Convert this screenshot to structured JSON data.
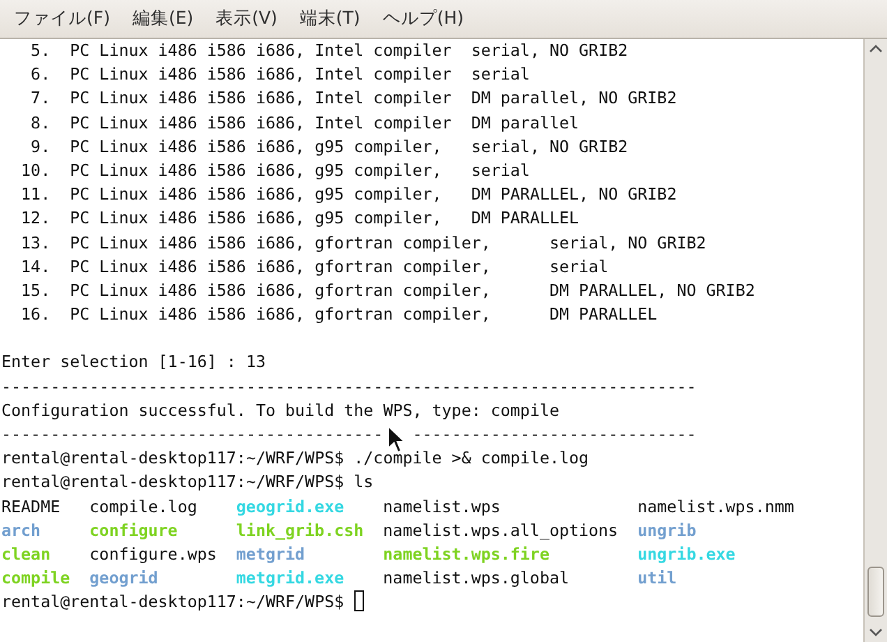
{
  "menu": [
    {
      "label": "ファイル(F)"
    },
    {
      "label": "編集(E)"
    },
    {
      "label": "表示(V)"
    },
    {
      "label": "端末(T)"
    },
    {
      "label": "ヘルプ(H)"
    }
  ],
  "terminal": {
    "lines": [
      {
        "kind": "text",
        "text": "   5.  PC Linux i486 i586 i686, Intel compiler  serial, NO GRIB2"
      },
      {
        "kind": "text",
        "text": "   6.  PC Linux i486 i586 i686, Intel compiler  serial"
      },
      {
        "kind": "text",
        "text": "   7.  PC Linux i486 i586 i686, Intel compiler  DM parallel, NO GRIB2"
      },
      {
        "kind": "text",
        "text": "   8.  PC Linux i486 i586 i686, Intel compiler  DM parallel"
      },
      {
        "kind": "text",
        "text": "   9.  PC Linux i486 i586 i686, g95 compiler,   serial, NO GRIB2"
      },
      {
        "kind": "text",
        "text": "  10.  PC Linux i486 i586 i686, g95 compiler,   serial"
      },
      {
        "kind": "text",
        "text": "  11.  PC Linux i486 i586 i686, g95 compiler,   DM PARALLEL, NO GRIB2"
      },
      {
        "kind": "text",
        "text": "  12.  PC Linux i486 i586 i686, g95 compiler,   DM PARALLEL"
      },
      {
        "kind": "text",
        "text": "  13.  PC Linux i486 i586 i686, gfortran compiler,      serial, NO GRIB2"
      },
      {
        "kind": "text",
        "text": "  14.  PC Linux i486 i586 i686, gfortran compiler,      serial"
      },
      {
        "kind": "text",
        "text": "  15.  PC Linux i486 i586 i686, gfortran compiler,      DM PARALLEL, NO GRIB2"
      },
      {
        "kind": "text",
        "text": "  16.  PC Linux i486 i586 i686, gfortran compiler,      DM PARALLEL"
      },
      {
        "kind": "blank"
      },
      {
        "kind": "text",
        "text": "Enter selection [1-16] : 13"
      },
      {
        "kind": "text",
        "text": "-----------------------------------------------------------------------"
      },
      {
        "kind": "text",
        "text": "Configuration successful. To build the WPS, type: compile"
      },
      {
        "kind": "split",
        "segments": [
          "---------------------------------------",
          "-----------------------------"
        ]
      },
      {
        "kind": "prompt",
        "text": "rental@rental-desktop117:~/WRF/WPS$ ./compile >& compile.log",
        "cursor": false
      },
      {
        "kind": "prompt",
        "text": "rental@rental-desktop117:~/WRF/WPS$ ls",
        "cursor": false
      },
      {
        "kind": "listing",
        "entries": [
          {
            "name": "README",
            "kind": "file"
          },
          {
            "name": "compile.log",
            "kind": "file"
          },
          {
            "name": "geogrid.exe",
            "kind": "link"
          },
          {
            "name": "namelist.wps",
            "kind": "file"
          },
          {
            "name": "namelist.wps.nmm",
            "kind": "file"
          },
          {
            "name": "arch",
            "kind": "dir"
          },
          {
            "name": "configure",
            "kind": "exec"
          },
          {
            "name": "link_grib.csh",
            "kind": "exec"
          },
          {
            "name": "namelist.wps.all_options",
            "kind": "file"
          },
          {
            "name": "ungrib",
            "kind": "dir"
          },
          {
            "name": "clean",
            "kind": "exec"
          },
          {
            "name": "configure.wps",
            "kind": "file"
          },
          {
            "name": "metgrid",
            "kind": "dir"
          },
          {
            "name": "namelist.wps.fire",
            "kind": "exec"
          },
          {
            "name": "ungrib.exe",
            "kind": "link"
          },
          {
            "name": "compile",
            "kind": "exec"
          },
          {
            "name": "geogrid",
            "kind": "dir"
          },
          {
            "name": "metgrid.exe",
            "kind": "link"
          },
          {
            "name": "namelist.wps.global",
            "kind": "file"
          },
          {
            "name": "util",
            "kind": "dir"
          }
        ]
      },
      {
        "kind": "prompt",
        "text": "rental@rental-desktop117:~/WRF/WPS$ ",
        "cursor": true
      }
    ]
  }
}
